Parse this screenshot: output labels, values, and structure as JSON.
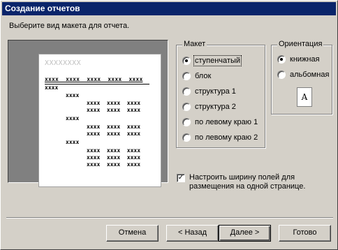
{
  "window": {
    "title": "Создание отчетов"
  },
  "prompt": "Выберите вид макета для отчета.",
  "preview": {
    "title_placeholder": "XXXXXXXX",
    "header_row": "xxxx  xxxx  xxxx  xxxx  xxxx",
    "rows": [
      "xxxx",
      "xxxx",
      "xxxx  xxxx  xxxx",
      "xxxx  xxxx  xxxx",
      "xxxx",
      "xxxx  xxxx  xxxx",
      "xxxx  xxxx  xxxx",
      "xxxx",
      "xxxx  xxxx  xxxx",
      "xxxx  xxxx  xxxx",
      "xxxx  xxxx  xxxx"
    ]
  },
  "layout_group": {
    "title": "Макет",
    "options": [
      {
        "label": "ступенчатый",
        "checked": true
      },
      {
        "label": "блок",
        "checked": false
      },
      {
        "label": "структура 1",
        "checked": false
      },
      {
        "label": "структура 2",
        "checked": false
      },
      {
        "label": "по левому краю 1",
        "checked": false
      },
      {
        "label": "по левому краю 2",
        "checked": false
      }
    ]
  },
  "orientation_group": {
    "title": "Ориентация",
    "options": [
      {
        "label": "книжная",
        "checked": true
      },
      {
        "label": "альбомная",
        "checked": false
      }
    ],
    "page_icon_letter": "A"
  },
  "fit_checkbox": {
    "checked": true,
    "mark": "✓",
    "label": "Настроить ширину полей для размещения на одной странице."
  },
  "buttons": {
    "cancel": "Отмена",
    "back": "< Назад",
    "next": "Далее >",
    "finish": "Готово"
  }
}
